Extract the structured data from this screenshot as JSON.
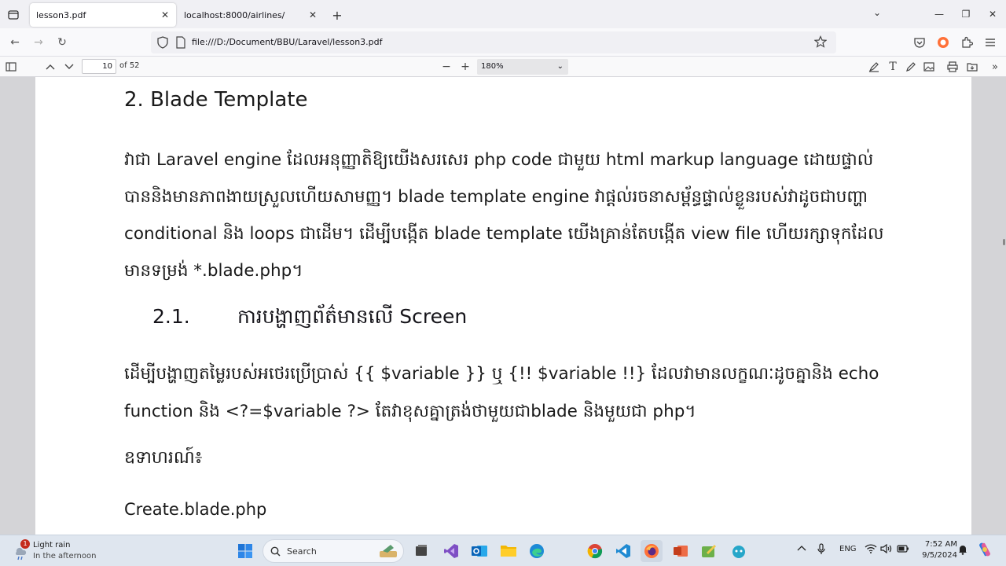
{
  "browser": {
    "tabs": [
      {
        "title": "lesson3.pdf",
        "active": true
      },
      {
        "title": "localhost:8000/airlines/",
        "active": false
      }
    ],
    "url": "file:///D:/Document/BBU/Laravel/lesson3.pdf"
  },
  "pdf_toolbar": {
    "page_number": "10",
    "page_count": "of 52",
    "zoom": "180%"
  },
  "document": {
    "heading": "2.  Blade Template",
    "paragraph1": "វាជា Laravel engine ដែលអនុញ្ញាតិឱ្យយើងសរសេរ php code ជាមួយ html markup language ដោយផ្ទាល់បាននិងមានភាពងាយស្រួលហើយសាមញ្ញ។ blade template engine វាផ្តល់រចនាសម្ព័ន្ធផ្ទាល់ខ្លួនរបស់វាដូចជាបញ្ហា conditional និង loops ជាដើម។ ដើម្បីបង្កើត blade template យើងគ្រាន់តែបង្កើត view file ហើយរក្សាទុកដែលមានទម្រង់  *.blade.php។",
    "subheading_number": "2.1.",
    "subheading_text": "ការបង្ហាញព័ត៌មានលើ Screen",
    "paragraph2": "ដើម្បីបង្ហាញតម្លៃរបស់អថេរប្រើប្រាស់ {{ $variable }} ឬ {!! $variable !!} ដែលវាមានលក្ខណៈដូចគ្នានិង echo function និង <?=$variable ?> តែវាខុសគ្នាត្រង់ថាមួយជាblade និងមួយជា php។",
    "example_label": "ឧទាហរណ៍៖",
    "filename": "Create.blade.php"
  },
  "taskbar": {
    "weather_badge": "1",
    "weather_title": "Light rain",
    "weather_sub": "In the afternoon",
    "search_label": "Search",
    "language": "ENG",
    "time": "7:52 AM",
    "date": "9/5/2024"
  }
}
